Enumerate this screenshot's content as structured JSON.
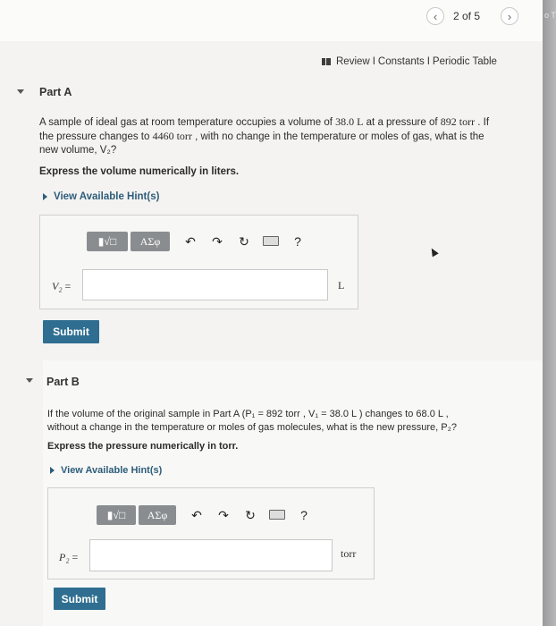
{
  "pager": {
    "prev_icon": "chevron-left-icon",
    "label": "2 of 5",
    "next_icon": "chevron-right-icon"
  },
  "edge_text": "o T",
  "links": {
    "review": "Review",
    "constants": "Constants",
    "periodic": "Periodic Table",
    "sep": "I"
  },
  "partA": {
    "title": "Part A",
    "question_line1_a": "A sample of ideal gas at room temperature occupies a volume of ",
    "question_line1_b": "38.0 L",
    "question_line1_c": " at a pressure of ",
    "question_line1_d": "892 torr",
    "question_line1_e": " . If",
    "question_line2_a": "the pressure changes to ",
    "question_line2_b": "4460 torr",
    "question_line2_c": " , with no change in the temperature or moles of gas, what is the",
    "question_line3": "new volume, V₂?",
    "instruction": "Express the volume numerically in liters.",
    "hint": "View Available Hint(s)",
    "toolbar": {
      "template": "▮√□",
      "greek": "ΑΣφ",
      "help": "?"
    },
    "var_label": "V₂",
    "equals": "=",
    "unit": "L",
    "submit": "Submit"
  },
  "partB": {
    "title": "Part B",
    "question_line1": "If the volume of the original sample in Part A (P₁ = 892 torr , V₁ = 38.0 L ) changes to 68.0 L ,",
    "question_line2": "without a change in the temperature or moles of gas molecules, what is the new pressure, P₂?",
    "instruction": "Express the pressure numerically in torr.",
    "hint": "View Available Hint(s)",
    "toolbar": {
      "template": "▮√□",
      "greek": "ΑΣφ",
      "help": "?"
    },
    "var_label": "P₂",
    "equals": "=",
    "unit": "torr",
    "submit": "Submit"
  },
  "colors": {
    "accent": "#2f6e91",
    "hint": "#2d5d7b"
  }
}
